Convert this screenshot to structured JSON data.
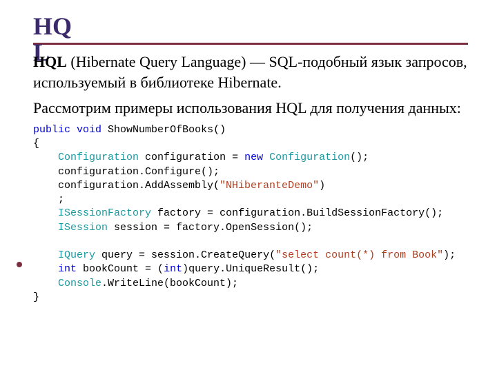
{
  "title": "HQL",
  "para1_strong": "HQL",
  "para1_rest": " (Hibernate Query Language) — SQL-подобный язык запросов, используемый в библиотеке Hibernate.",
  "para2": "Рассмотрим примеры использования HQL для получения данных:",
  "code": {
    "l1a": "public",
    "l1b": "void",
    "l1c": " ShowNumberOfBooks()",
    "l2": "{",
    "l3a": "    ",
    "l3b": "Configuration",
    "l3c": " configuration = ",
    "l3d": "new",
    "l3e": " ",
    "l3f": "Configuration",
    "l3g": "();",
    "l4": "    configuration.Configure();",
    "l5a": "    configuration.AddAssembly(",
    "l5b": "\"NHiberanteDemo\"",
    "l5c": ")",
    "l5d": "    ;",
    "l6a": "    ",
    "l6b": "ISessionFactory",
    "l6c": " factory = configuration.BuildSessionFactory();",
    "l7a": "    ",
    "l7b": "ISession",
    "l7c": " session = factory.OpenSession();",
    "blank": "",
    "l8a": "    ",
    "l8b": "IQuery",
    "l8c": " query = session.CreateQuery(",
    "l8d": "\"select count(*) from Book\"",
    "l8e": ");",
    "l9a": "    ",
    "l9b": "int",
    "l9c": " bookCount = (",
    "l9d": "int",
    "l9e": ")query.UniqueResult();",
    "l10a": "    ",
    "l10b": "Console",
    "l10c": ".WriteLine(bookCount);",
    "l11": "}"
  }
}
